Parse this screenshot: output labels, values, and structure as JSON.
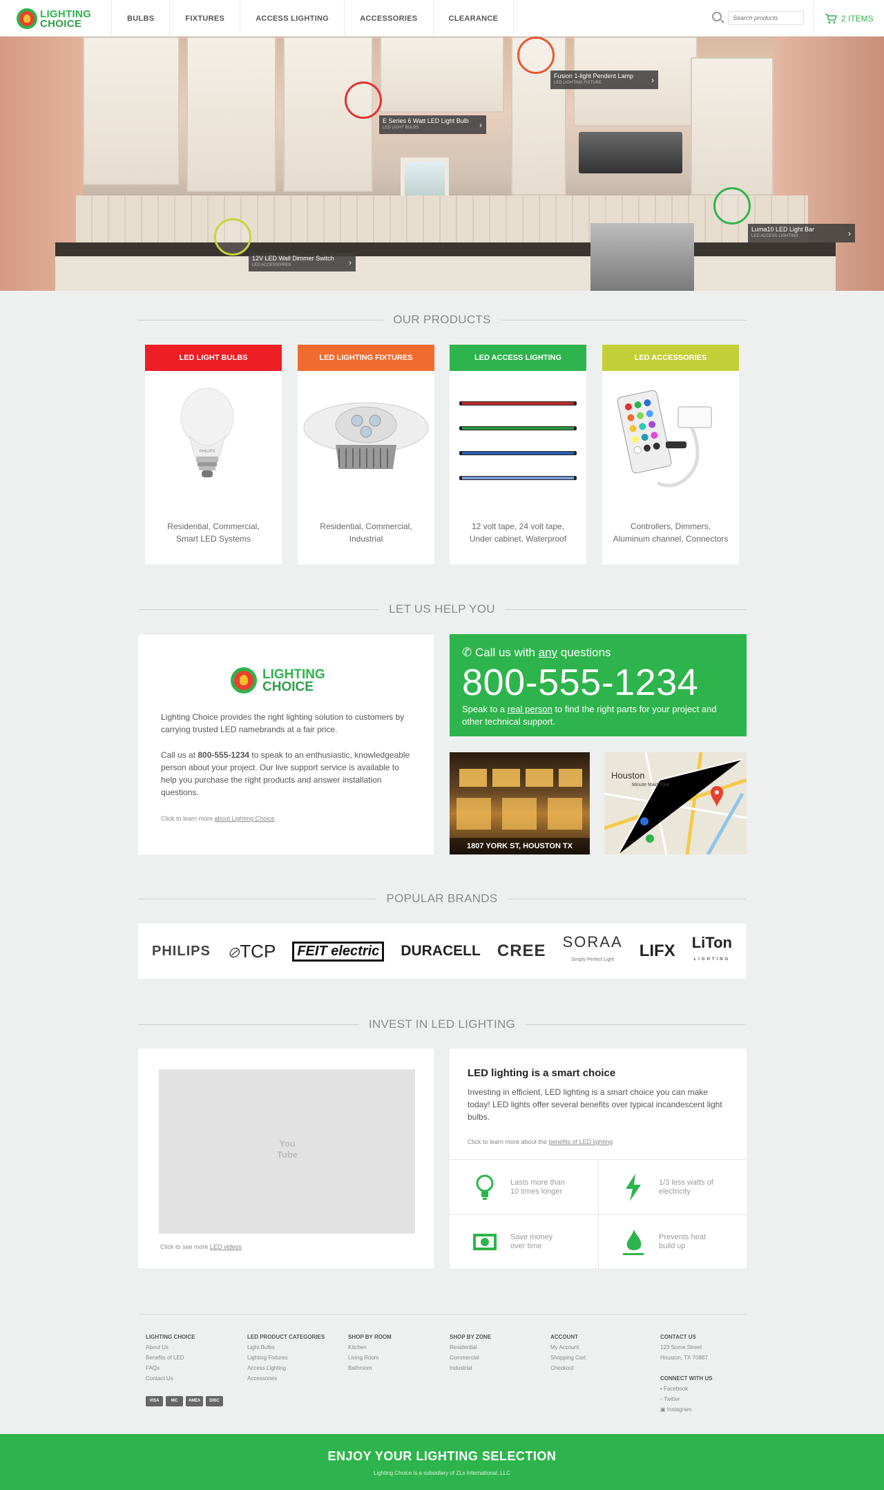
{
  "header": {
    "logo": {
      "line1": "LIGHTING",
      "line2": "CHOICE"
    },
    "nav": [
      "BULBS",
      "FIXTURES",
      "ACCESS LIGHTING",
      "ACCESSORIES",
      "CLEARANCE"
    ],
    "search_placeholder": "Search products",
    "cart_label": "2 ITEMS"
  },
  "hero": {
    "hotspots": [
      {
        "name": "Fusion 1-light Pendent Lamp",
        "category": "LED LIGHTING FIXTURE",
        "color": "#e8562e"
      },
      {
        "name": "E Series 6 Watt LED Light Bulb",
        "category": "LED LIGHT BULBS",
        "color": "#e23030"
      },
      {
        "name": "Luma10 LED Light Bar",
        "category": "LED ACCESS LIGHTING",
        "color": "#2eb44c"
      },
      {
        "name": "12V LED Wall Dimmer Switch",
        "category": "LED ACCESSORIES",
        "color": "#c8d43a"
      }
    ]
  },
  "products": {
    "title": "OUR PRODUCTS",
    "items": [
      {
        "header": "LED LIGHT BULBS",
        "color": "#ee1e25",
        "desc1": "Residential, Commercial,",
        "desc2": "Smart LED Systems"
      },
      {
        "header": "LED LIGHTING FIXTURES",
        "color": "#f26b2e",
        "desc1": "Residential, Commercial,",
        "desc2": "Industrial"
      },
      {
        "header": "LED ACCESS LIGHTING",
        "color": "#2eb44c",
        "desc1": "12 volt tape, 24 volt tape,",
        "desc2": "Under cabinet, Waterproof"
      },
      {
        "header": "LED ACCESSORIES",
        "color": "#c3cf36",
        "desc1": "Controllers, Dimmers,",
        "desc2": "Aluminum channel, Connectors"
      }
    ],
    "bulb_brand": "PHILIPS"
  },
  "help": {
    "title": "LET US HELP YOU",
    "about": {
      "p1": "Lighting Choice  provides the right lighting solution to customers by carrying trusted LED namebrands at a fair price.",
      "p2_prefix": "Call us at ",
      "p2_phone": "800-555-1234",
      "p2_suffix": " to speak to an enthusiastic, knowledgeable person about your project. Our live support service is available to help you purchase the right products and answer installation questions.",
      "link_prefix": "Click to learn more ",
      "link_text": "about Lighting Choice"
    },
    "call": {
      "q_prefix": "Call us with ",
      "q_emph": "any",
      "q_suffix": " questions",
      "phone": "800-555-1234",
      "sub_prefix": "Speak to a ",
      "sub_link": "real person",
      "sub_suffix": " to find the right parts for your project and other technical support."
    },
    "store_caption": "1807 YORK ST, HOUSTON TX",
    "map": {
      "city": "Houston",
      "area": "Minute Maid Park"
    }
  },
  "brands": {
    "title": "POPULAR BRANDS",
    "items": [
      "PHILIPS",
      "TCP",
      "FEIT electric",
      "DURACELL",
      "CREE",
      "SORAA",
      "LIFX",
      "LiTon"
    ],
    "soraa_tag": "Simply Perfect Light",
    "liton_tag": "LIGHTING"
  },
  "invest": {
    "title": "INVEST IN LED LIGHTING",
    "video_link_prefix": "Click to see more ",
    "video_link": "LED videos",
    "youtube_logo": "You Tube",
    "heading": "LED lighting is a smart choice",
    "text": "Investing in efficient, LED lighting is a smart choice you can make today! LED lights offer several benefits over typical incandescent light bulbs.",
    "link_prefix": "Click to learn more about the ",
    "link_text": "benefits of LED lighting",
    "features": [
      {
        "l1": "Lasts more than",
        "l2": "10 times longer",
        "icon": "bulb-icon"
      },
      {
        "l1": "1/3 less watts of",
        "l2": "electricity",
        "icon": "lightning-icon"
      },
      {
        "l1": "Save money",
        "l2": "over time",
        "icon": "money-icon"
      },
      {
        "l1": "Prevents heat",
        "l2": "build up",
        "icon": "flame-icon"
      }
    ]
  },
  "footer": {
    "cols": [
      {
        "h": "LIGHTING CHOICE",
        "items": [
          "About Us",
          "Benefits of LED",
          "FAQs",
          "Contact Us"
        ]
      },
      {
        "h": "LED PRODUCT CATEGORIES",
        "items": [
          "Light Bulbs",
          "Lighting Fixtures",
          "Access Lighting",
          "Accessories"
        ]
      },
      {
        "h": "SHOP BY ROOM",
        "items": [
          "Kitchen",
          "Living Room",
          "Bathroom"
        ]
      },
      {
        "h": "SHOP BY ZONE",
        "items": [
          "Residential",
          "Commercial",
          "Industrial"
        ]
      },
      {
        "h": "ACCOUNT",
        "items": [
          "My Account",
          "Shopping Cart",
          "Checkout"
        ]
      },
      {
        "h": "CONTACT US",
        "items": [
          "123 Some Street",
          "Houston, TX 70887"
        ]
      }
    ],
    "connect": {
      "h": "CONNECT WITH US",
      "items": [
        "Facebook",
        "Twitter",
        "Instagram"
      ]
    },
    "cards": [
      "VISA",
      "MC",
      "AMEX",
      "DISC"
    ],
    "banner": "ENJOY YOUR LIGHTING SELECTION",
    "subsidiary": "Lighting Choice is a subsidiary of ZLs International, LLC"
  }
}
